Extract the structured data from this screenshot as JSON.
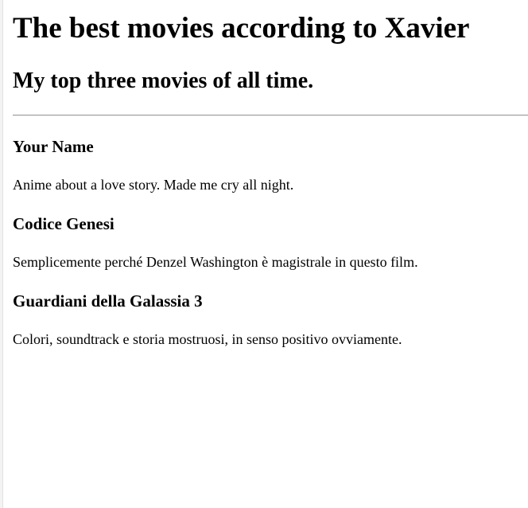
{
  "page": {
    "heading": "The best movies according to Xavier",
    "subheading": "My top three movies of all time."
  },
  "movies": [
    {
      "title": "Your Name",
      "description": "Anime about a love story. Made me cry all night."
    },
    {
      "title": "Codice Genesi",
      "description": "Semplicemente perché Denzel Washington è magistrale in questo film."
    },
    {
      "title": "Guardiani della Galassia 3",
      "description": "Colori, soundtrack e storia mostruosi, in senso positivo ovviamente."
    }
  ]
}
